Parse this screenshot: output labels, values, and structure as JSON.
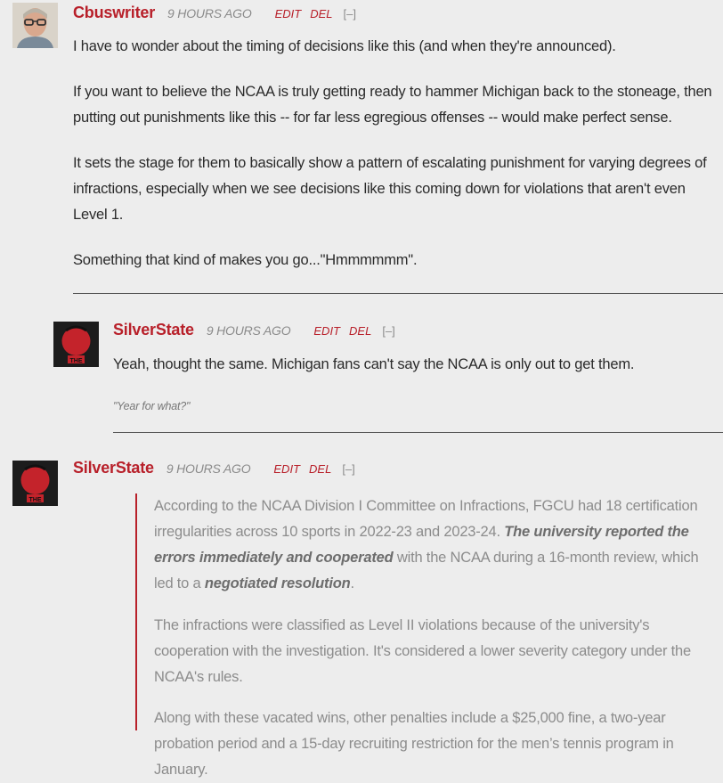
{
  "comments": [
    {
      "author": "Cbuswriter",
      "time": "9 HOURS AGO",
      "edit": "EDIT",
      "del": "DEL",
      "collapse": "[–]",
      "paragraphs": [
        "I have to wonder about the timing of decisions like this (and when they're announced).",
        "If you want to believe the NCAA is truly getting ready to hammer Michigan back to the stoneage, then putting out punishments like this -- for far less egregious offenses -- would make perfect sense.",
        "It sets the stage for them to basically show a pattern of escalating punishment for varying degrees of infractions, especially when we see decisions like this coming down for violations that aren't even Level 1.",
        "Something that kind of makes you go...\"Hmmmmmm\"."
      ]
    },
    {
      "author": "SilverState",
      "time": "9 HOURS AGO",
      "edit": "EDIT",
      "del": "DEL",
      "collapse": "[–]",
      "text": "Yeah, thought the same. Michigan fans can't say the NCAA is only out to get them.",
      "signature": "\"Year for what?\""
    },
    {
      "author": "SilverState",
      "time": "9 HOURS AGO",
      "edit": "EDIT",
      "del": "DEL",
      "collapse": "[–]",
      "quote": {
        "p1_a": "According to the NCAA Division I Committee on Infractions, FGCU had 18 certification irregularities across 10 sports in 2022-23 and 2023-24. ",
        "p1_b": "The university reported the errors immediately and cooperated",
        "p1_c": " with the NCAA during a 16-month review, which led to a ",
        "p1_d": "negotiated resolution",
        "p1_e": ".",
        "p2": "The infractions were classified as Level II violations because of the university's cooperation with the investigation. It's considered a lower severity category under the NCAA's rules.",
        "p3": "Along with these vacated wins, other penalties include a $25,000 fine, a two-year probation period and a 15-day recruiting restriction for the men’s tennis program in January."
      }
    }
  ],
  "colors": {
    "accent": "#b8202a",
    "background": "#ededed",
    "quote_text": "#8c8c8c"
  }
}
